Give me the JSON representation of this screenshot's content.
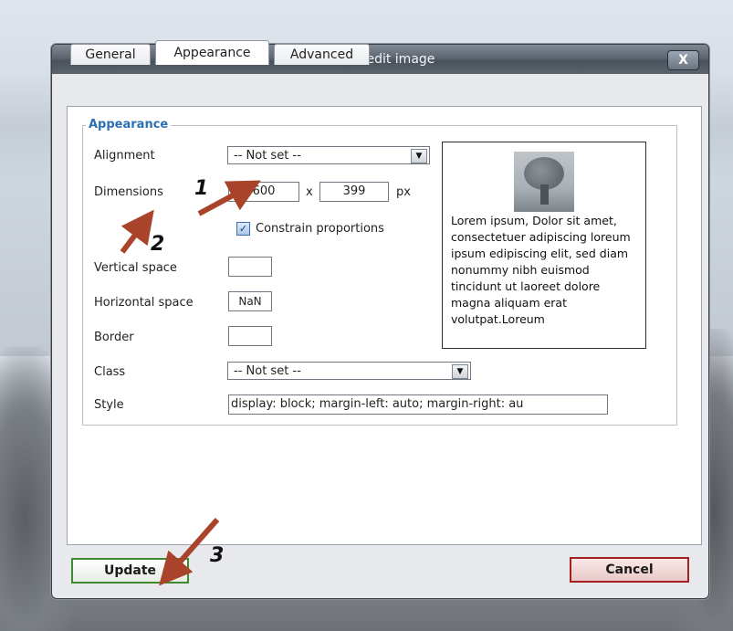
{
  "dialog": {
    "title": "Insert/edit image",
    "close_label": "X"
  },
  "tabs": [
    {
      "label": "General",
      "active": false
    },
    {
      "label": "Appearance",
      "active": true
    },
    {
      "label": "Advanced",
      "active": false
    }
  ],
  "appearance": {
    "legend": "Appearance",
    "alignment": {
      "label": "Alignment",
      "value": "-- Not set --"
    },
    "dimensions": {
      "label": "Dimensions",
      "width": "600",
      "separator": "x",
      "height": "399",
      "unit": "px"
    },
    "constrain": {
      "label": "Constrain proportions",
      "checked": true
    },
    "vertical_space": {
      "label": "Vertical space",
      "value": ""
    },
    "horizontal_space": {
      "label": "Horizontal space",
      "value": "NaN"
    },
    "border": {
      "label": "Border",
      "value": ""
    },
    "class": {
      "label": "Class",
      "value": "-- Not set --"
    },
    "style": {
      "label": "Style",
      "value": "display: block; margin-left: auto; margin-right: au"
    }
  },
  "preview": {
    "text": "Lorem ipsum, Dolor sit amet, consectetuer adipiscing loreum ipsum edipiscing elit, sed diam nonummy nibh euismod tincidunt ut laoreet dolore magna aliquam erat volutpat.Loreum"
  },
  "buttons": {
    "update": "Update",
    "cancel": "Cancel"
  },
  "annotations": {
    "n1": "1",
    "n2": "2",
    "n3": "3"
  },
  "colors": {
    "accent": "#2b6fb5",
    "arrow": "#a9442b",
    "update_border": "#3f8a2c",
    "cancel_border": "#a72020"
  }
}
